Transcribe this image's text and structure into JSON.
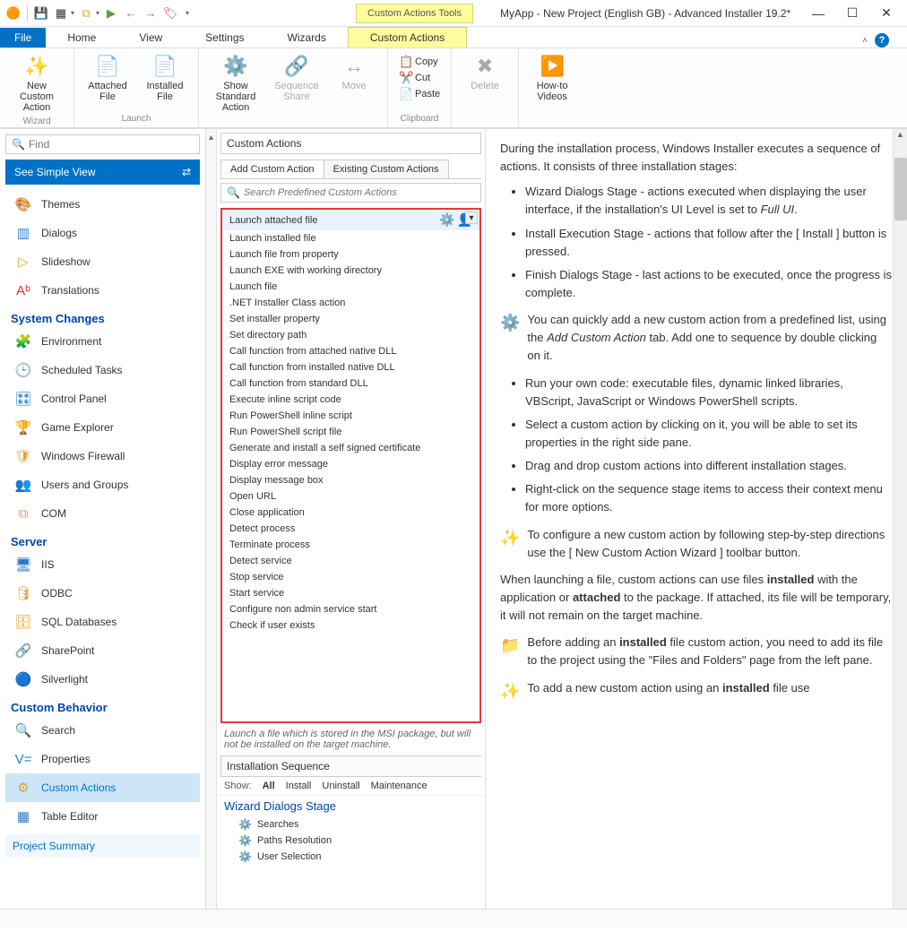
{
  "title": "MyApp - New Project (English GB) - Advanced Installer 19.2*",
  "tooltab": "Custom Actions Tools",
  "menus": {
    "file": "File",
    "home": "Home",
    "view": "View",
    "settings": "Settings",
    "wizards": "Wizards",
    "custom": "Custom Actions"
  },
  "ribbon": {
    "g1": "Wizard",
    "newCA": "New Custom\nAction",
    "g2": "Launch",
    "attFile": "Attached\nFile",
    "instFile": "Installed\nFile",
    "showStd": "Show Standard\nAction",
    "seqShare": "Sequence\nShare",
    "move": "Move",
    "g3": "Clipboard",
    "copy": "Copy",
    "cut": "Cut",
    "paste": "Paste",
    "delete": "Delete",
    "videos": "How-to\nVideos"
  },
  "find": "Find",
  "simpleView": "See Simple View",
  "nav": {
    "themes": "Themes",
    "dialogs": "Dialogs",
    "slideshow": "Slideshow",
    "translations": "Translations",
    "hSystem": "System Changes",
    "env": "Environment",
    "sched": "Scheduled Tasks",
    "cpanel": "Control Panel",
    "gexp": "Game Explorer",
    "wfw": "Windows Firewall",
    "ugrp": "Users and Groups",
    "com": "COM",
    "hServer": "Server",
    "iis": "IIS",
    "odbc": "ODBC",
    "sqldb": "SQL Databases",
    "sp": "SharePoint",
    "sl": "Silverlight",
    "hCustom": "Custom Behavior",
    "search": "Search",
    "props": "Properties",
    "cact": "Custom Actions",
    "tbled": "Table Editor",
    "projsum": "Project Summary"
  },
  "mid": {
    "title": "Custom Actions",
    "tab1": "Add Custom Action",
    "tab2": "Existing Custom Actions",
    "searchPH": "Search Predefined Custom Actions",
    "items": [
      "Launch attached file",
      "Launch installed file",
      "Launch file from property",
      "Launch EXE with working directory",
      "Launch file",
      ".NET Installer Class action",
      "Set installer property",
      "Set directory path",
      "Call function from attached native DLL",
      "Call function from installed native DLL",
      "Call function from standard DLL",
      "Execute inline script code",
      "Run PowerShell inline script",
      "Run PowerShell script file",
      "Generate and install a self signed certificate",
      "Display error message",
      "Display message box",
      "Open URL",
      "Close application",
      "Detect process",
      "Terminate process",
      "Detect service",
      "Stop service",
      "Start service",
      "Configure non admin service start",
      "Check if user exists"
    ],
    "desc": "Launch a file which is stored in the MSI package, but will not be installed on the target machine.",
    "seqTitle": "Installation Sequence",
    "show": "Show:",
    "all": "All",
    "install": "Install",
    "uninstall": "Uninstall",
    "maint": "Maintenance",
    "stage": "Wizard Dialogs Stage",
    "seqItems": [
      "Searches",
      "Paths Resolution",
      "User Selection"
    ]
  },
  "help": {
    "p1": "During the installation process, Windows Installer executes a sequence of actions. It consists of three installation stages:",
    "b1a": "Wizard Dialogs Stage - actions executed when displaying the user interface, if the installation's UI Level is set to ",
    "b1b": "Full UI",
    "b2": "Install Execution Stage - actions that follow after the [ Install ] button is pressed.",
    "b3": "Finish Dialogs Stage - last actions to be executed, once the progress is complete.",
    "t1a": "You can quickly add a new custom action from a predefined list, using the ",
    "t1b": "Add Custom Action",
    "t1c": " tab. Add one to sequence by double clicking on it.",
    "c1": "Run your own code: executable files, dynamic linked libraries, VBScript, JavaScript or Windows PowerShell scripts.",
    "c2": "Select a custom action by clicking on it, you will be able to set its properties in the right side pane.",
    "c3": "Drag and drop custom actions into different installation stages.",
    "c4": "Right-click on the sequence stage items to access their context menu for more options.",
    "t2": "To configure a new custom action by following step-by-step directions use the [ New Custom Action Wizard ] toolbar button.",
    "p2a": "When launching a file, custom actions can use files ",
    "p2b": "installed",
    "p2c": " with the application or ",
    "p2d": "attached",
    "p2e": " to the package. If attached, its file will be temporary, it will not remain on the target machine.",
    "t3a": "Before adding an ",
    "t3b": "installed",
    "t3c": " file custom action, you need to add its file to the project using the \"Files and Folders\" page from the left pane.",
    "t4a": "To add a new custom action using an ",
    "t4b": "installed",
    "t4c": " file use"
  }
}
